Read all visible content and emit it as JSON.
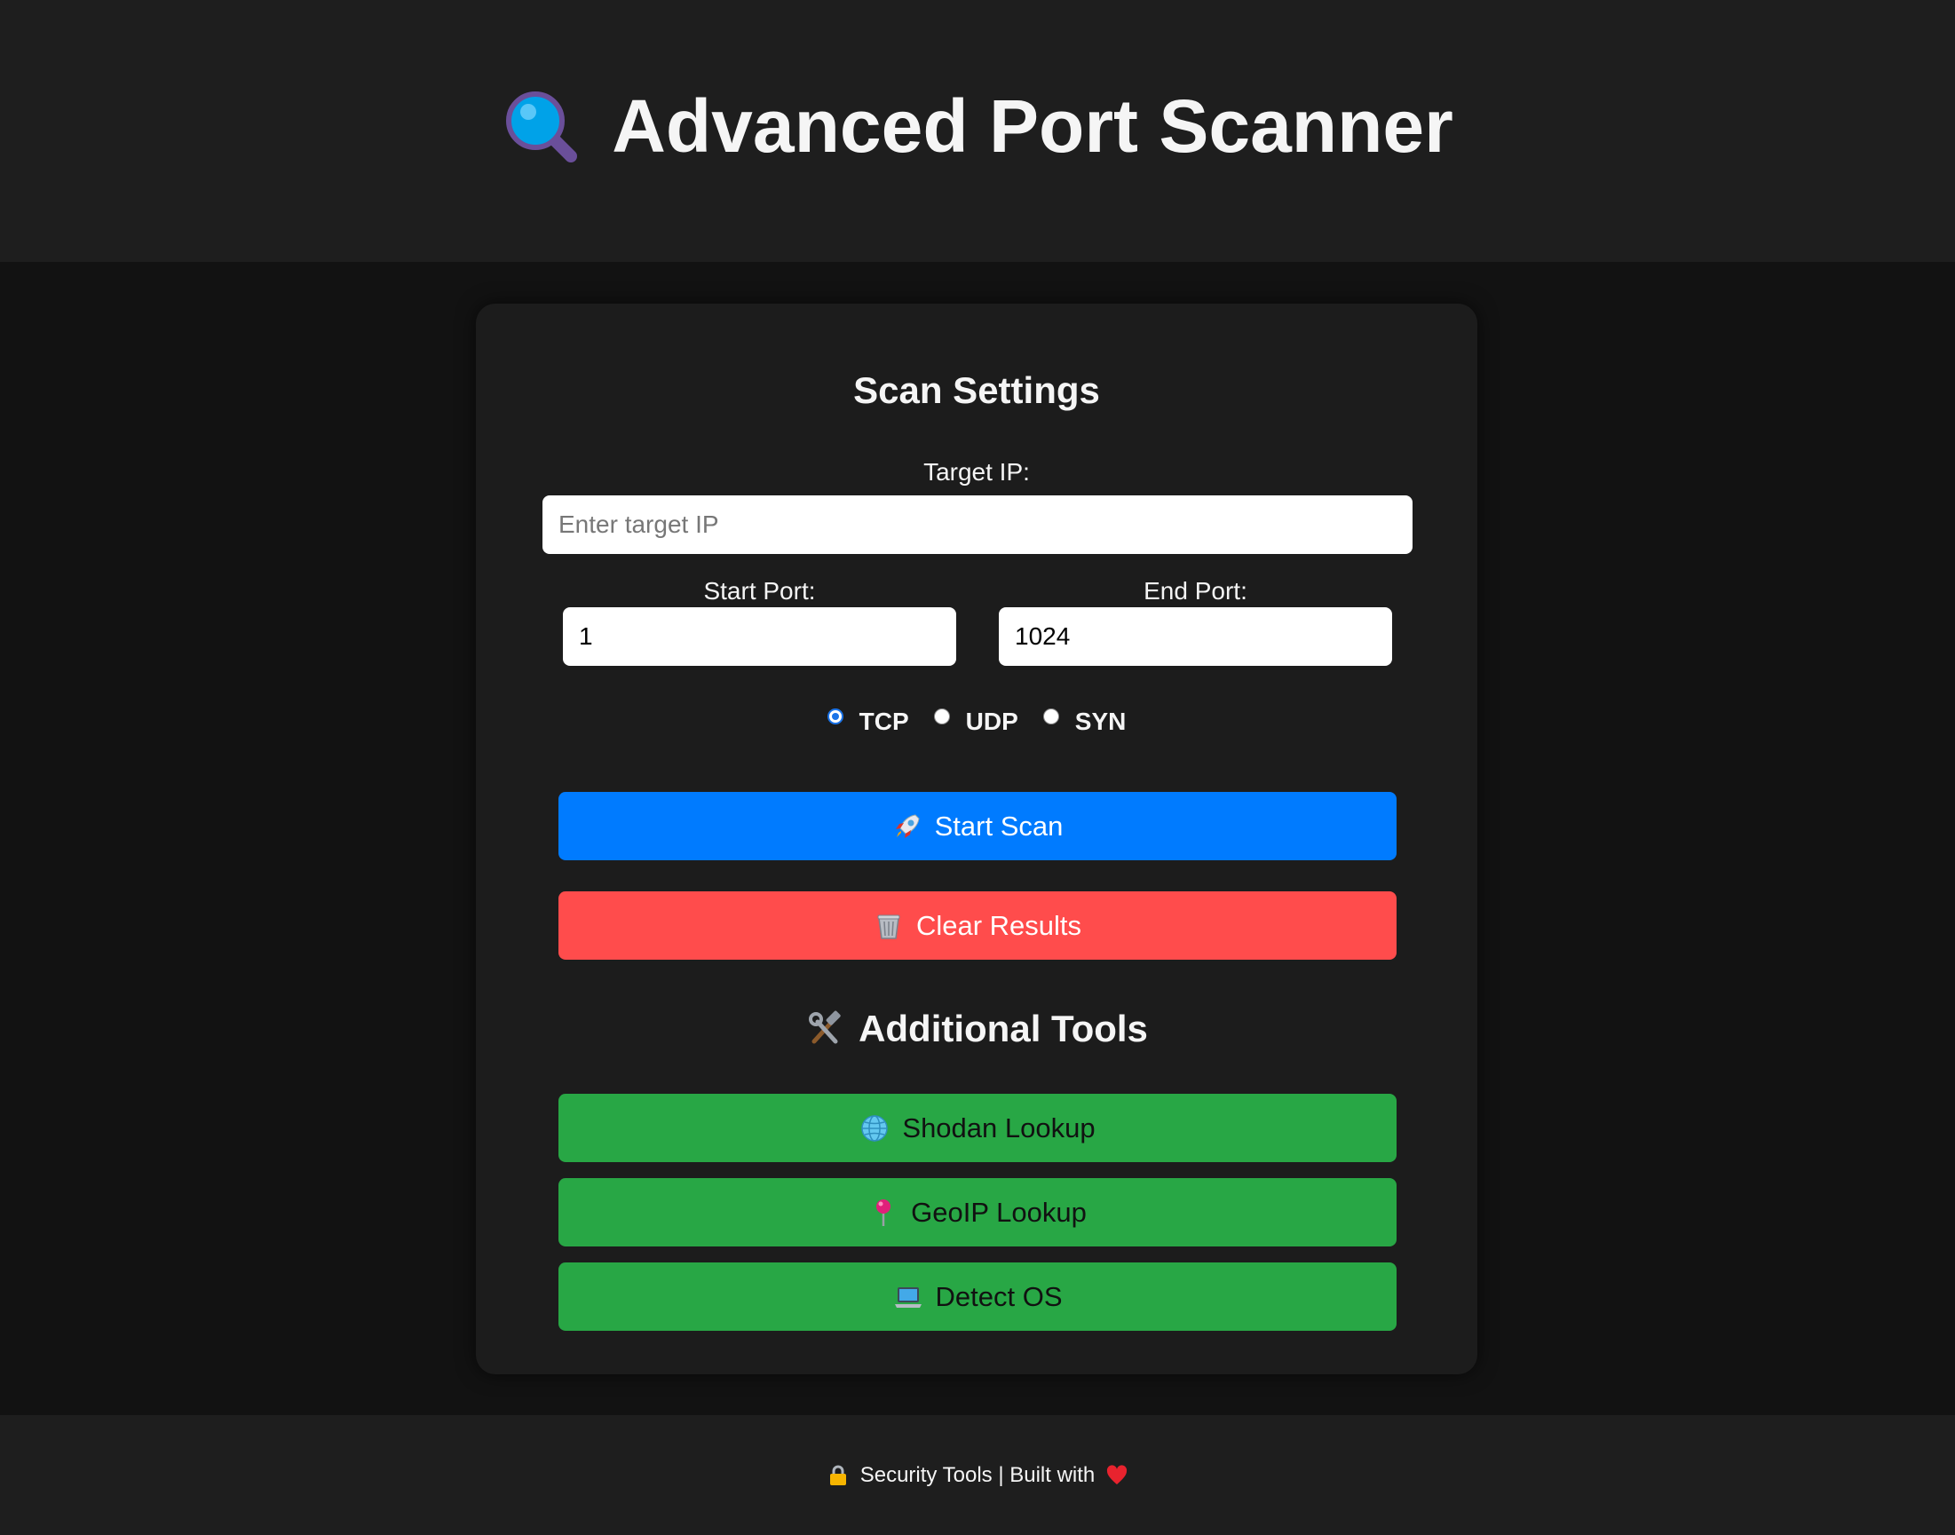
{
  "header": {
    "title": "Advanced Port Scanner",
    "icon": "magnifying-glass-icon"
  },
  "scan_settings": {
    "title": "Scan Settings",
    "target_ip_label": "Target IP:",
    "target_ip_value": "",
    "target_ip_placeholder": "Enter target IP",
    "start_port_label": "Start Port:",
    "start_port_value": "1",
    "end_port_label": "End Port:",
    "end_port_value": "1024",
    "protocols": [
      {
        "label": "TCP",
        "checked": true
      },
      {
        "label": "UDP",
        "checked": false
      },
      {
        "label": "SYN",
        "checked": false
      }
    ]
  },
  "actions": {
    "start_scan_label": "Start Scan",
    "start_scan_icon": "rocket-icon",
    "clear_results_label": "Clear Results",
    "clear_results_icon": "wastebasket-icon"
  },
  "additional_tools": {
    "title": "Additional Tools",
    "icon": "hammer-wrench-icon",
    "buttons": [
      {
        "label": "Shodan Lookup",
        "icon": "globe-icon"
      },
      {
        "label": "GeoIP Lookup",
        "icon": "pushpin-icon"
      },
      {
        "label": "Detect OS",
        "icon": "laptop-icon"
      }
    ]
  },
  "footer": {
    "text": "Security Tools | Built with",
    "lock_icon": "lock-icon",
    "heart_icon": "heart-icon"
  },
  "colors": {
    "page_background": "#121212",
    "header_background": "#1e1e1e",
    "card_background": "#1c1c1c",
    "primary_blue": "#007bff",
    "danger_red": "#ff4c4c",
    "success_green": "#28a745"
  }
}
